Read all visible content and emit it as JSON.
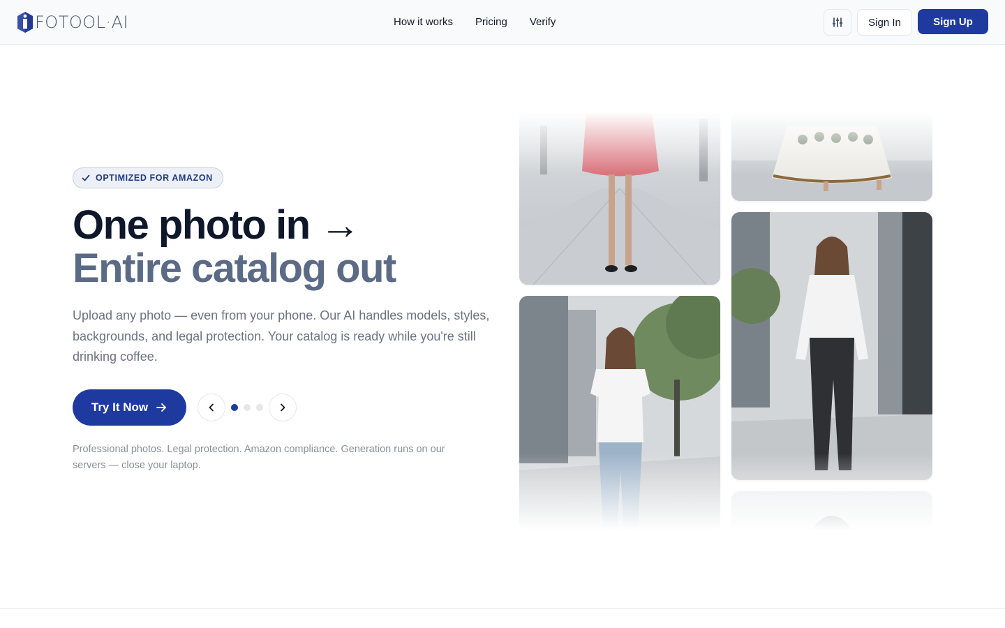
{
  "brand": {
    "name": "FOTOOL·AI",
    "accent": "#1e3a9f"
  },
  "nav": {
    "items": [
      {
        "label": "How it works"
      },
      {
        "label": "Pricing"
      },
      {
        "label": "Verify"
      }
    ]
  },
  "header": {
    "settings_icon": "sliders-icon",
    "sign_in_label": "Sign In",
    "sign_up_label": "Sign Up"
  },
  "hero": {
    "badge": "OPTIMIZED FOR AMAZON",
    "title_line1": "One photo in →",
    "title_line2": "Entire catalog out",
    "description": "Upload any photo — even from your phone. Our AI handles models, styles, backgrounds, and legal protection. Your catalog is ready while you're still drinking coffee.",
    "cta_label": "Try It Now",
    "carousel": {
      "slides": 3,
      "active_index": 0
    },
    "footnote": "Professional photos. Legal protection. Amazon compliance. Generation runs on our servers — close your laptop."
  },
  "gallery": {
    "images": [
      {
        "name": "red-skirt-model-photo"
      },
      {
        "name": "embroidered-dress-photo"
      },
      {
        "name": "white-tee-jeans-model-photo"
      },
      {
        "name": "white-blouse-black-jeans-model-photo"
      },
      {
        "name": "partial-model-photo"
      }
    ]
  }
}
